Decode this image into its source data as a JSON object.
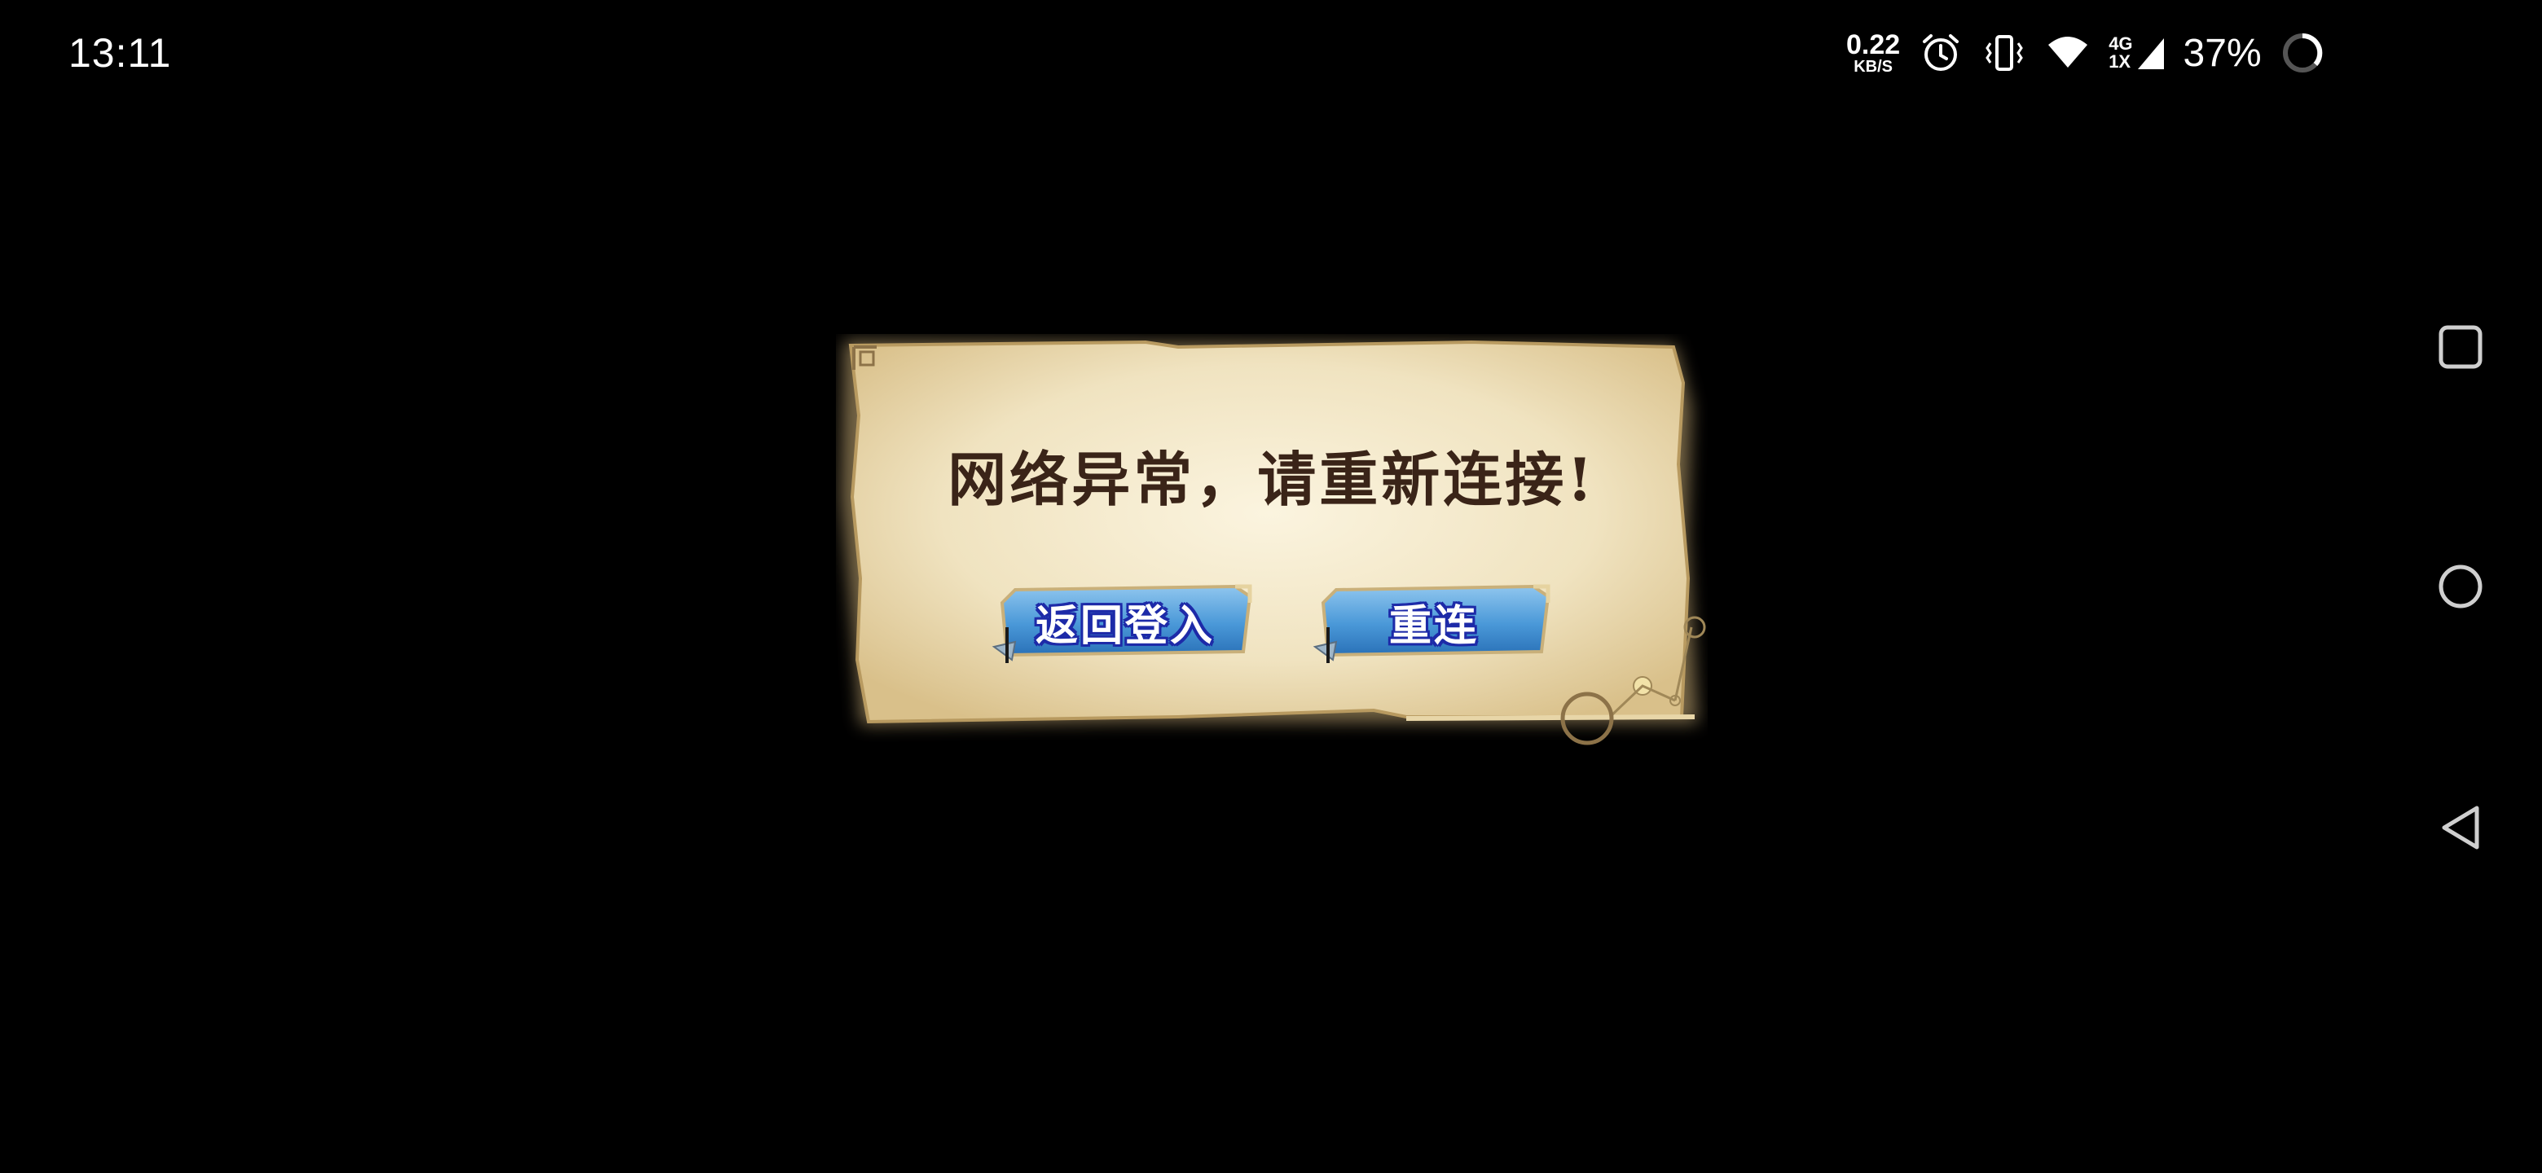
{
  "status_bar": {
    "time": "13:11",
    "net_speed": "0.22",
    "net_speed_unit": "KB/S",
    "net_type_top": "4G",
    "net_type_bottom": "1X",
    "battery": "37%"
  },
  "dialog": {
    "message": "网络异常，请重新连接!",
    "back_to_login_label": "返回登入",
    "reconnect_label": "重连"
  },
  "colors": {
    "parchment": "#f0e3c0",
    "button_blue": "#4a98d8",
    "text_dark": "#3a2418"
  },
  "nav_bar": {
    "icons": [
      "recent-apps-icon",
      "home-icon",
      "back-icon"
    ]
  }
}
